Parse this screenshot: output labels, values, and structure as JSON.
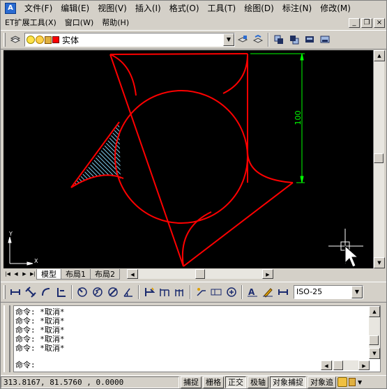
{
  "menu": {
    "row1": [
      "文件(F)",
      "编辑(E)",
      "视图(V)",
      "插入(I)",
      "格式(O)",
      "工具(T)",
      "绘图(D)",
      "标注(N)",
      "修改(M)"
    ],
    "row2": [
      "ET扩展工具(X)",
      "窗口(W)",
      "帮助(H)"
    ]
  },
  "window_controls": {
    "minimize": "_",
    "restore": "❐",
    "close": "×"
  },
  "layer": {
    "current_name": "实体",
    "color": "#ff0000"
  },
  "drawing": {
    "dimension_text": "100",
    "ucs_x": "X",
    "ucs_y": "Y",
    "line_color": "#ff0000",
    "dim_color": "#00ff00",
    "hatch_color": "#7ec8e8"
  },
  "tabs": [
    "模型",
    "布局1",
    "布局2"
  ],
  "active_tab": "模型",
  "dim_style": "ISO-25",
  "command": {
    "history": [
      "命令: *取消*",
      "命令: *取消*",
      "命令: *取消*",
      "命令: *取消*",
      "命令: *取消*"
    ],
    "prompt": "命令:"
  },
  "status": {
    "coords": "313.8167, 81.5760 , 0.0000",
    "buttons": [
      "捕捉",
      "栅格",
      "正交",
      "极轴",
      "对象捕捉",
      "对象追"
    ]
  }
}
